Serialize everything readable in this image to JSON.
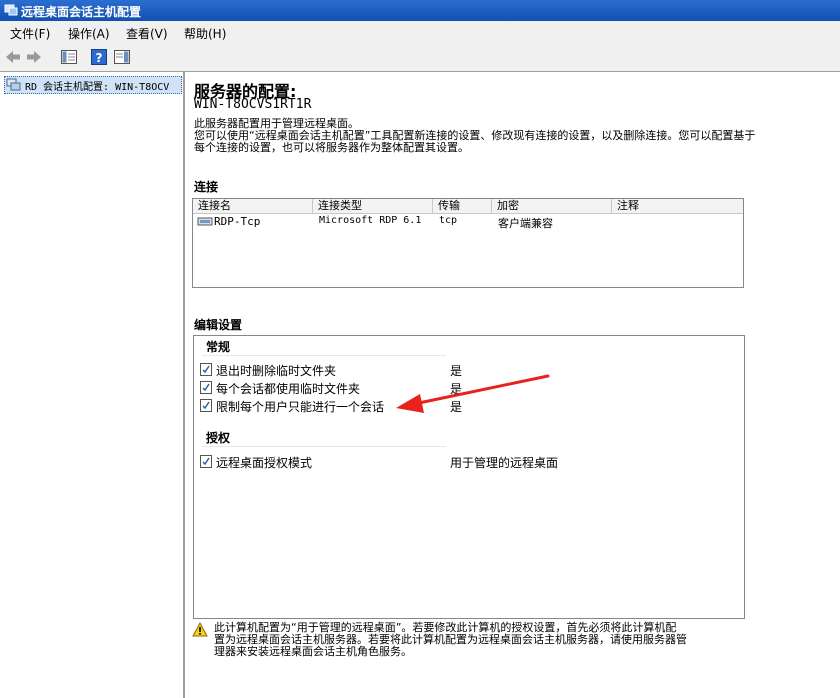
{
  "window": {
    "title": "远程桌面会话主机配置"
  },
  "menu": [
    "文件(F)",
    "操作(A)",
    "查看(V)",
    "帮助(H)"
  ],
  "tree": {
    "root": "RD 会话主机配置: WIN-T8OCV"
  },
  "main": {
    "heading": "服务器的配置:",
    "server": "WIN-T8OCVS1RT1R",
    "desc_line1": "此服务器配置用于管理远程桌面。",
    "desc_line2": "您可以使用“远程桌面会话主机配置”工具配置新连接的设置、修改现有连接的设置，以及删除连接。您可以配置基于",
    "desc_line3": "每个连接的设置，也可以将服务器作为整体配置其设置。",
    "connections_title": "连接",
    "columns": [
      "连接名",
      "连接类型",
      "传输",
      "加密",
      "注释"
    ],
    "rows": [
      {
        "name": "RDP-Tcp",
        "type": "Microsoft RDP 6.1",
        "transport": "tcp",
        "encryption": "客户端兼容",
        "comment": ""
      }
    ],
    "edit_title": "编辑设置",
    "group_general": "常规",
    "general": [
      {
        "name": "退出时删除临时文件夹",
        "value": "是"
      },
      {
        "name": "每个会话都使用临时文件夹",
        "value": "是"
      },
      {
        "name": "限制每个用户只能进行一个会话",
        "value": "是"
      }
    ],
    "group_license": "授权",
    "license": [
      {
        "name": "远程桌面授权模式",
        "value": "用于管理的远程桌面"
      }
    ],
    "notice_line1": "此计算机配置为“用于管理的远程桌面”。若要修改此计算机的授权设置，首先必须将此计算机配",
    "notice_line2": "置为远程桌面会话主机服务器。若要将此计算机配置为远程桌面会话主机服务器，请使用服务器管",
    "notice_line3": "理器来安装远程桌面会话主机角色服务。"
  },
  "colors": {
    "title_bar": "#1a5fc4",
    "annotation_arrow": "#e8221c"
  }
}
